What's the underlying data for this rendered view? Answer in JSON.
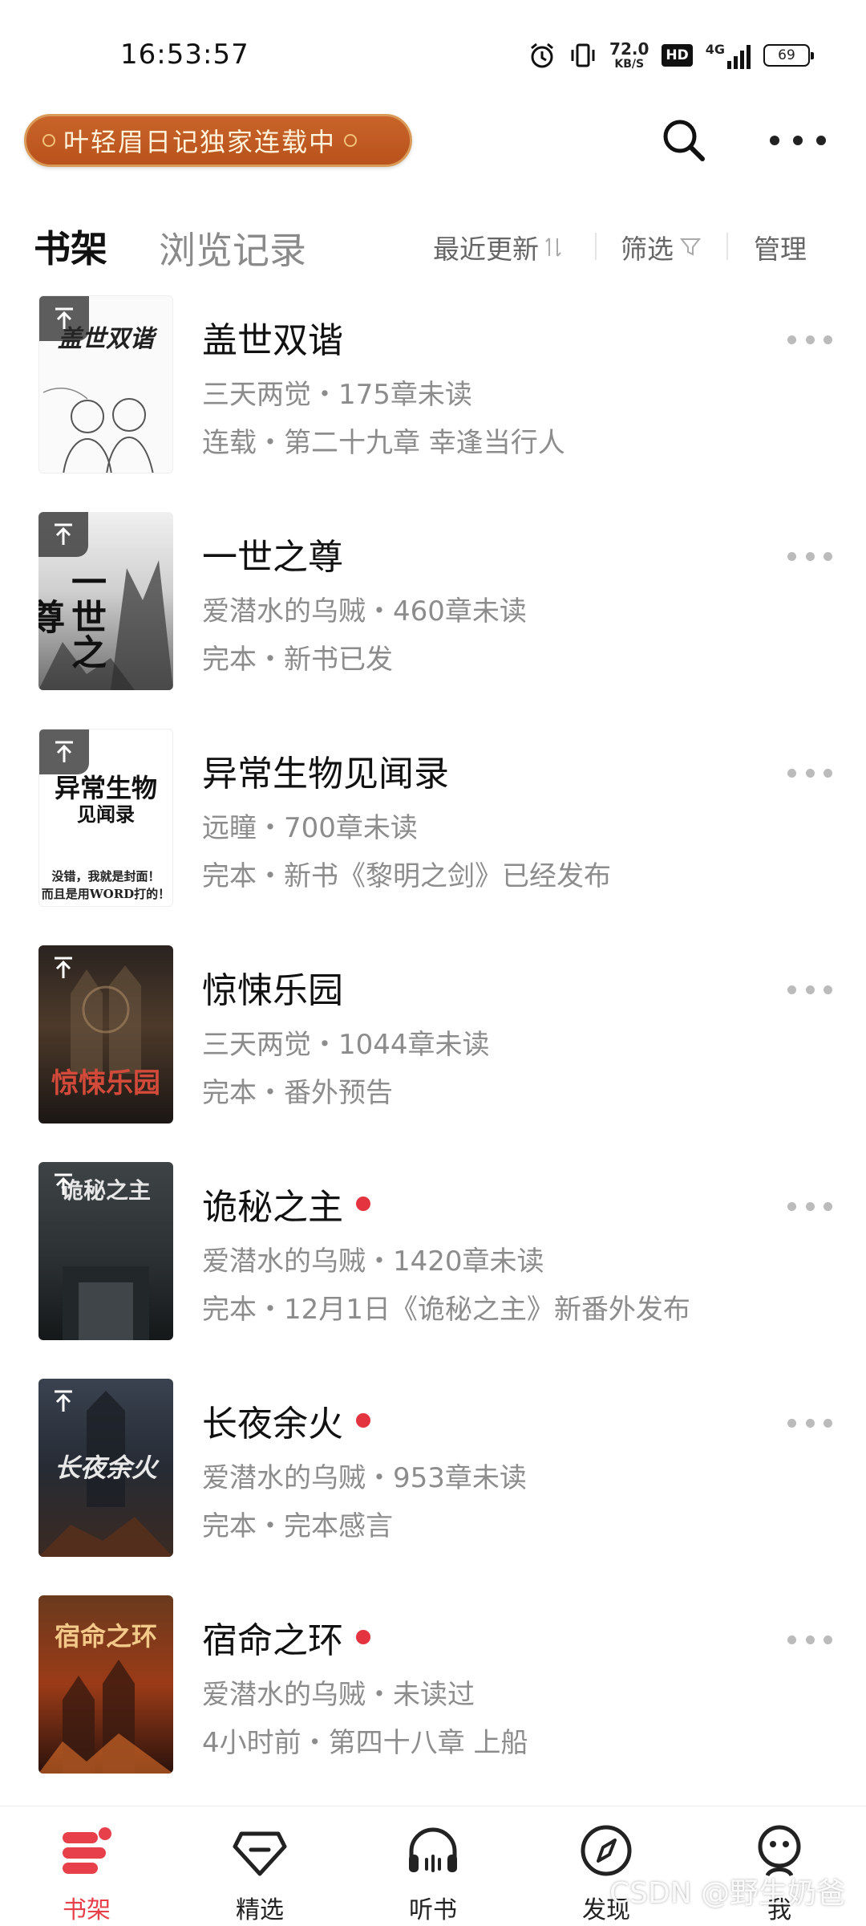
{
  "status_bar": {
    "time": "16:53:57",
    "net_speed_value": "72.0",
    "net_speed_unit": "KB/S",
    "hd": "HD",
    "network": "4G",
    "battery": "69"
  },
  "header": {
    "banner_text": "叶轻眉日记独家连载中"
  },
  "tabs": {
    "shelf": "书架",
    "history": "浏览记录",
    "sort": "最近更新",
    "filter": "筛选",
    "manage": "管理"
  },
  "books": [
    {
      "title": "盖世双谐",
      "author_status": "三天两觉・175章未读",
      "update": "连载・第二十九章 幸逢当行人",
      "cover_text": "盖世双谐",
      "new": false
    },
    {
      "title": "一世之尊",
      "author_status": "爱潜水的乌贼・460章未读",
      "update": "完本・新书已发",
      "cover_text": "一世之尊",
      "new": false
    },
    {
      "title": "异常生物见闻录",
      "author_status": "远瞳・700章未读",
      "update": "完本・新书《黎明之剑》已经发布",
      "cover_text": "异常生物",
      "cover_sub": "见闻录",
      "cover_note1": "没错，我就是封面！",
      "cover_note2": "而且是用WORD打的！",
      "new": false
    },
    {
      "title": "惊悚乐园",
      "author_status": "三天两觉・1044章未读",
      "update": "完本・番外预告",
      "cover_text": "惊悚乐园",
      "new": false
    },
    {
      "title": "诡秘之主",
      "author_status": "爱潜水的乌贼・1420章未读",
      "update": "完本・12月1日《诡秘之主》新番外发布",
      "cover_text": "诡秘之主",
      "new": true
    },
    {
      "title": "长夜余火",
      "author_status": "爱潜水的乌贼・953章未读",
      "update": "完本・完本感言",
      "cover_text": "长夜余火",
      "new": true
    },
    {
      "title": "宿命之环",
      "author_status": "爱潜水的乌贼・未读过",
      "update": "4小时前・第四十八章 上船",
      "cover_text": "宿命之环",
      "new": true
    }
  ],
  "bottom_nav": [
    {
      "label": "书架",
      "active": true
    },
    {
      "label": "精选",
      "active": false
    },
    {
      "label": "听书",
      "active": false
    },
    {
      "label": "发现",
      "active": false
    },
    {
      "label": "我",
      "active": false
    }
  ],
  "watermark": "CSDN @野生奶爸",
  "colors": {
    "accent": "#e8404b",
    "text_primary": "#111111",
    "text_secondary": "#8c8c8c"
  }
}
